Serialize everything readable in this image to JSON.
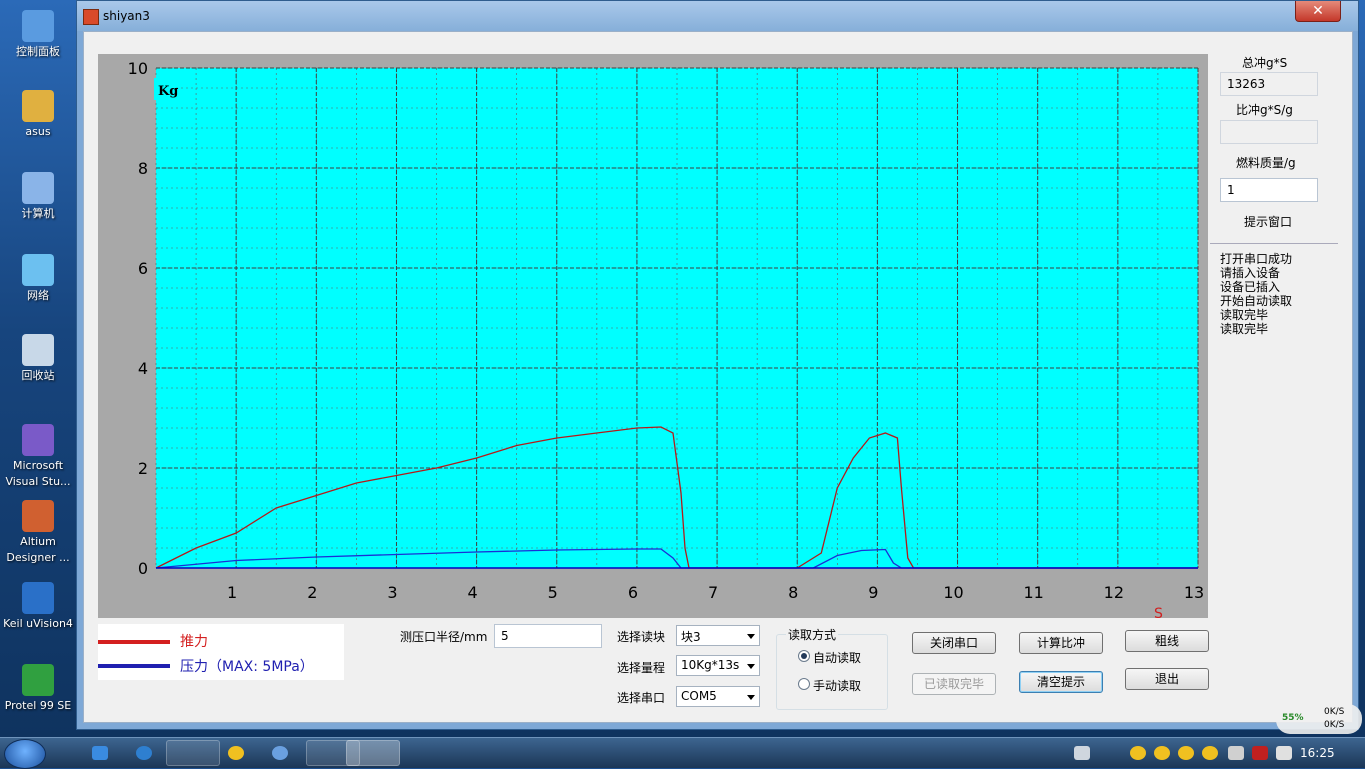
{
  "desktop_icons": [
    {
      "label": "控制面板",
      "icon": "control-panel-icon"
    },
    {
      "label": "asus",
      "icon": "user-folder-icon"
    },
    {
      "label": "计算机",
      "icon": "computer-icon"
    },
    {
      "label": "网络",
      "icon": "network-icon"
    },
    {
      "label": "回收站",
      "icon": "recycle-bin-icon"
    },
    {
      "label": "Microsoft Visual Stu...",
      "icon": "visual-studio-icon"
    },
    {
      "label": "Altium Designer ...",
      "icon": "altium-icon"
    },
    {
      "label": "Keil uVision4",
      "icon": "keil-icon"
    },
    {
      "label": "Protel 99 SE",
      "icon": "protel-icon"
    }
  ],
  "window": {
    "title": "shiyan3",
    "close_label": "✕"
  },
  "chart_data": {
    "type": "line",
    "ylabel": "Kg",
    "xlabel": "S",
    "xlim": [
      0,
      13
    ],
    "ylim": [
      0,
      10
    ],
    "x_ticks": [
      1,
      2,
      3,
      4,
      5,
      6,
      7,
      8,
      9,
      10,
      11,
      12,
      13
    ],
    "y_ticks": [
      0,
      2,
      4,
      6,
      8,
      10
    ],
    "grid": true,
    "colors": {
      "plot_bg": "#00ffff",
      "thrust": "#b51a1a",
      "pressure": "#1a2fd6",
      "grid": "#606060"
    },
    "series": [
      {
        "name": "推力",
        "x": [
          0,
          0.25,
          0.5,
          1,
          1.5,
          2,
          2.5,
          3,
          3.5,
          4,
          4.5,
          5,
          5.5,
          6,
          6.3,
          6.45,
          6.55,
          6.6,
          6.65,
          7,
          8,
          8.3,
          8.5,
          8.7,
          8.9,
          9.1,
          9.25,
          9.3,
          9.38,
          9.45,
          10,
          13
        ],
        "values": [
          0,
          0.2,
          0.4,
          0.7,
          1.2,
          1.45,
          1.7,
          1.85,
          2.0,
          2.2,
          2.45,
          2.6,
          2.7,
          2.8,
          2.82,
          2.7,
          1.5,
          0.4,
          0,
          0,
          0,
          0.3,
          1.6,
          2.2,
          2.6,
          2.7,
          2.6,
          1.6,
          0.2,
          0,
          0,
          0
        ]
      },
      {
        "name": "压力（MAX: 5MPa）",
        "x": [
          0,
          1,
          2,
          3,
          4,
          5,
          6,
          6.3,
          6.45,
          6.55,
          7,
          8.2,
          8.5,
          8.8,
          9.1,
          9.2,
          9.3,
          13
        ],
        "values": [
          0,
          0.15,
          0.22,
          0.27,
          0.32,
          0.36,
          0.38,
          0.38,
          0.2,
          0,
          0,
          0,
          0.25,
          0.35,
          0.37,
          0.1,
          0,
          0
        ]
      }
    ]
  },
  "legend": {
    "thrust": "推力",
    "pressure": "压力（MAX: 5MPa）"
  },
  "form": {
    "radius_label": "测压口半径/mm",
    "radius_value": "5",
    "block_label": "选择读块",
    "block_value": "块3",
    "range_label": "选择量程",
    "range_value": "10Kg*13s",
    "port_label": "选择串口",
    "port_value": "COM5",
    "read_mode_title": "读取方式",
    "auto_read": "自动读取",
    "manual_read": "手动读取"
  },
  "buttons": {
    "close_port": "关闭串口",
    "read_done": "已读取完毕",
    "calc": "计算比冲",
    "clear": "清空提示",
    "thick": "粗线",
    "exit": "退出"
  },
  "side": {
    "total_impulse_label": "总冲g*S",
    "total_impulse_value": "13263",
    "specific_impulse_label": "比冲g*S/g",
    "specific_impulse_value": "",
    "fuel_mass_label": "燃料质量/g",
    "fuel_mass_value": "1",
    "hint_title": "提示窗口",
    "messages": [
      "打开串口成功",
      "请插入设备",
      "设备已插入",
      "开始自动读取",
      "读取完毕",
      "读取完毕"
    ]
  },
  "taskbar": {
    "clock": "16:25",
    "net_pct": "55%",
    "up": "0K/S",
    "down": "0K/S"
  }
}
